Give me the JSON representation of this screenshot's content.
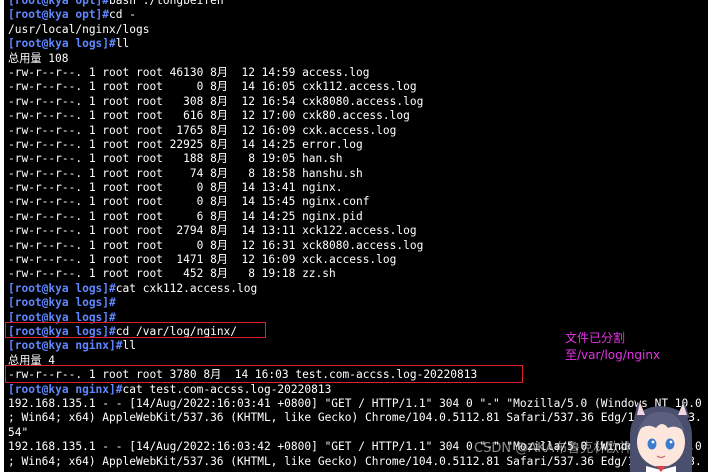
{
  "terminal": {
    "lines": [
      {
        "type": "prompt",
        "prompt": "[root@kya opt]#",
        "cmd": "bash ./tongbeifen"
      },
      {
        "type": "prompt",
        "prompt": "[root@kya opt]#",
        "cmd": "cd -"
      },
      {
        "type": "plain",
        "text": "/usr/local/nginx/logs"
      },
      {
        "type": "prompt",
        "prompt": "[root@kya logs]#",
        "cmd": "ll"
      },
      {
        "type": "plain",
        "text": "总用量 108"
      },
      {
        "type": "plain",
        "text": "-rw-r--r--. 1 root root 46130 8月  12 14:59 access.log"
      },
      {
        "type": "plain",
        "text": "-rw-r--r--. 1 root root     0 8月  14 16:05 cxk112.access.log"
      },
      {
        "type": "plain",
        "text": "-rw-r--r--. 1 root root   308 8月  12 16:54 cxk8080.access.log"
      },
      {
        "type": "plain",
        "text": "-rw-r--r--. 1 root root   616 8月  12 17:00 cxk80.access.log"
      },
      {
        "type": "plain",
        "text": "-rw-r--r--. 1 root root  1765 8月  12 16:09 cxk.access.log"
      },
      {
        "type": "plain",
        "text": "-rw-r--r--. 1 root root 22925 8月  14 14:25 error.log"
      },
      {
        "type": "plain",
        "text": "-rw-r--r--. 1 root root   188 8月   8 19:05 han.sh"
      },
      {
        "type": "plain",
        "text": "-rw-r--r--. 1 root root    74 8月   8 18:58 hanshu.sh"
      },
      {
        "type": "plain",
        "text": "-rw-r--r--. 1 root root     0 8月  14 13:41 nginx."
      },
      {
        "type": "plain",
        "text": "-rw-r--r--. 1 root root     0 8月  14 15:45 nginx.conf"
      },
      {
        "type": "plain",
        "text": "-rw-r--r--. 1 root root     6 8月  14 14:25 nginx.pid"
      },
      {
        "type": "plain",
        "text": "-rw-r--r--. 1 root root  2794 8月  14 13:11 xck122.access.log"
      },
      {
        "type": "plain",
        "text": "-rw-r--r--. 1 root root     0 8月  12 16:31 xck8080.access.log"
      },
      {
        "type": "plain",
        "text": "-rw-r--r--. 1 root root  1471 8月  12 16:09 xck.access.log"
      },
      {
        "type": "plain",
        "text": "-rw-r--r--. 1 root root   452 8月   8 19:18 zz.sh"
      },
      {
        "type": "prompt",
        "prompt": "[root@kya logs]#",
        "cmd": "cat cxk112.access.log"
      },
      {
        "type": "prompt",
        "prompt": "[root@kya logs]#",
        "cmd": ""
      },
      {
        "type": "prompt",
        "prompt": "[root@kya logs]#",
        "cmd": ""
      },
      {
        "type": "prompt",
        "prompt": "[root@kya logs]#",
        "cmd": "cd /var/log/nginx/"
      },
      {
        "type": "prompt",
        "prompt": "[root@kya nginx]#",
        "cmd": "ll"
      },
      {
        "type": "plain",
        "text": "总用量 4"
      },
      {
        "type": "plain",
        "text": "-rw-r--r--. 1 root root 3780 8月  14 16:03 test.com-accss.log-20220813"
      },
      {
        "type": "prompt",
        "prompt": "[root@kya nginx]#",
        "cmd": "cat test.com-accss.log-20220813"
      },
      {
        "type": "plain",
        "text": "192.168.135.1 - - [14/Aug/2022:16:03:41 +0800] \"GET / HTTP/1.1\" 304 0 \"-\" \"Mozilla/5.0 (Windows NT 10.0"
      },
      {
        "type": "plain",
        "text": "; Win64; x64) AppleWebKit/537.36 (KHTML, like Gecko) Chrome/104.0.5112.81 Safari/537.36 Edg/104.0.1293."
      },
      {
        "type": "plain",
        "text": "54\""
      },
      {
        "type": "plain",
        "text": "192.168.135.1 - - [14/Aug/2022:16:03:42 +0800] \"GET / HTTP/1.1\" 304 0 \"-\" \"Mozilla/5.0 (Windows NT 10.0"
      },
      {
        "type": "plain",
        "text": "; Win64; x64) AppleWebKit/537.36 (KHTML, like Gecko) Chrome/104.0.5112.81 Safari/537.36 Edg/104.0.1293."
      }
    ]
  },
  "annotation": {
    "note": "文件已分割至/var/log/nginx",
    "color": "#e632e6"
  },
  "watermark": {
    "text": "CSDN @AKA布鲁克林欧神仙"
  },
  "colors": {
    "background": "#000000",
    "prompt": "#5f87ff",
    "text": "#ffffff",
    "highlight_box": "#e0202a"
  },
  "icons": {
    "mascot": "anime-girl-avatar-icon"
  }
}
